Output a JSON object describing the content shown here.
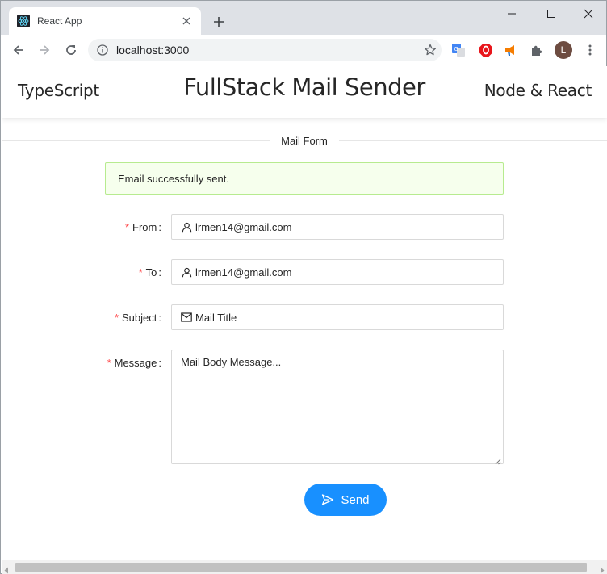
{
  "browser": {
    "tab_title": "React App",
    "url": "localhost:3000",
    "avatar_initial": "L",
    "accent_color": "#1890ff"
  },
  "header": {
    "left": "TypeScript",
    "title": "FullStack Mail Sender",
    "right": "Node & React"
  },
  "form": {
    "section_title": "Mail Form",
    "alert": "Email successfully sent.",
    "fields": {
      "from": {
        "label": "From",
        "value": "lrmen14@gmail.com",
        "icon": "user-icon"
      },
      "to": {
        "label": "To",
        "value": "lrmen14@gmail.com",
        "icon": "user-icon"
      },
      "subject": {
        "label": "Subject",
        "value": "Mail Title",
        "icon": "mail-icon"
      },
      "message": {
        "label": "Message",
        "value": "Mail Body Message..."
      }
    },
    "required_marker": "*",
    "label_suffix": ":",
    "send_label": "Send"
  }
}
